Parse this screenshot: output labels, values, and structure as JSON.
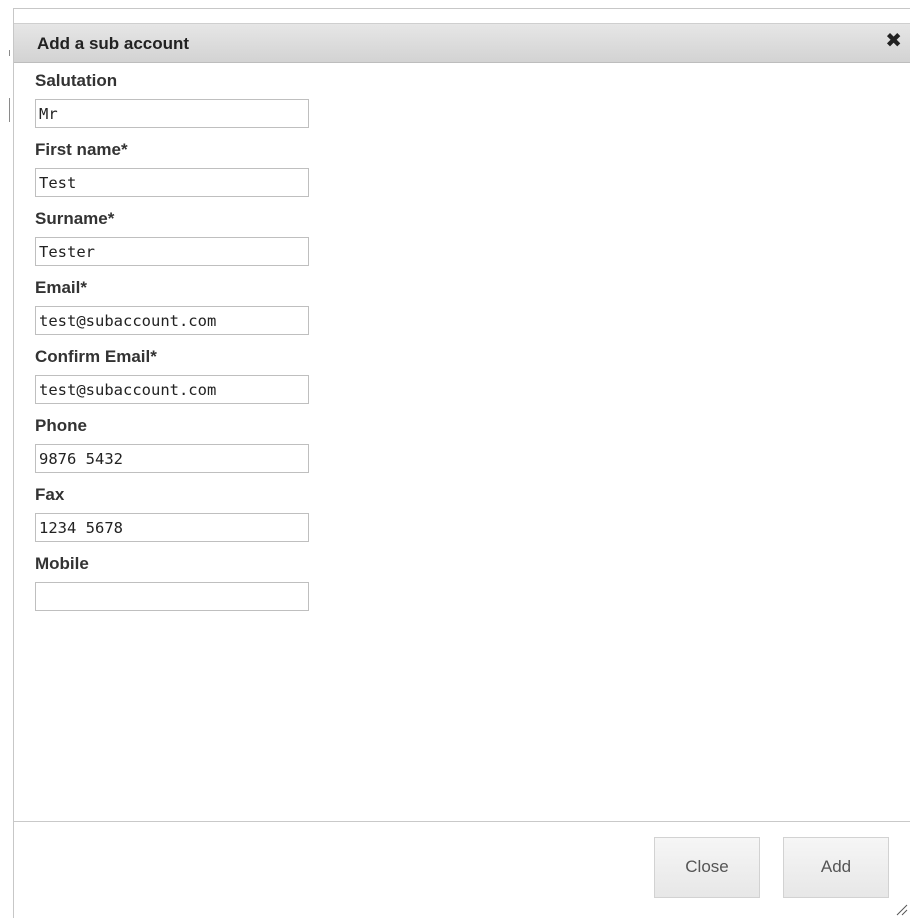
{
  "dialog": {
    "title": "Add a sub account",
    "close_icon": "close-icon"
  },
  "form": {
    "fields": [
      {
        "label": "Salutation",
        "value": "Mr"
      },
      {
        "label": "First name*",
        "value": "Test"
      },
      {
        "label": "Surname*",
        "value": "Tester"
      },
      {
        "label": "Email*",
        "value": "test@subaccount.com"
      },
      {
        "label": "Confirm Email*",
        "value": "test@subaccount.com"
      },
      {
        "label": "Phone",
        "value": "9876 5432"
      },
      {
        "label": "Fax",
        "value": "1234 5678"
      },
      {
        "label": "Mobile",
        "value": ""
      }
    ]
  },
  "footer": {
    "close_label": "Close",
    "add_label": "Add"
  },
  "icons": {
    "resize": "resize-handle-icon"
  }
}
